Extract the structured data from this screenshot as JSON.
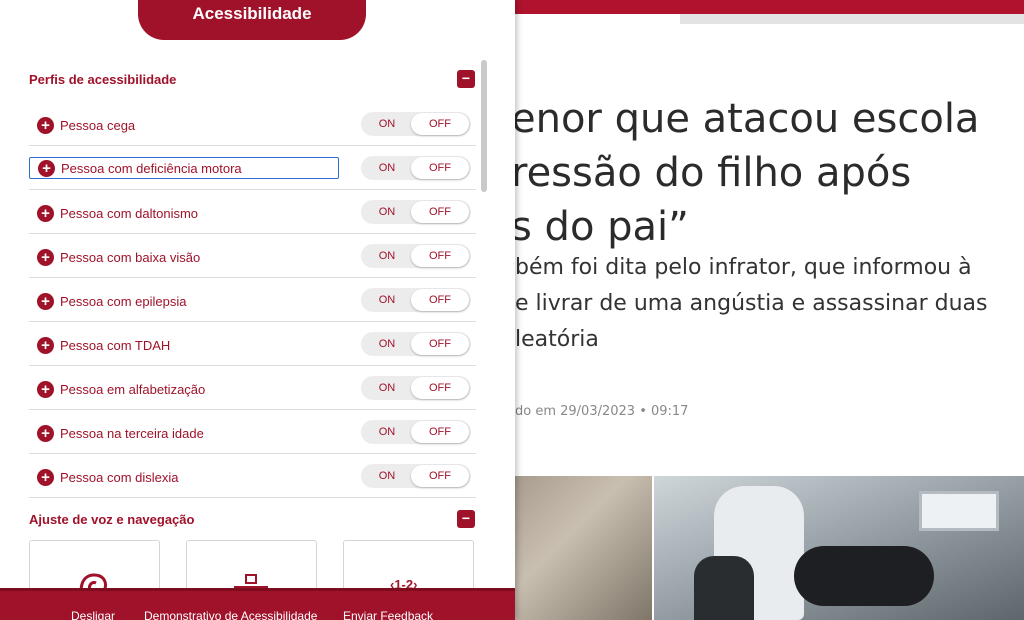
{
  "article": {
    "headline_lines": [
      "enor que atacou escola",
      "ressão do filho após",
      "s do pai”"
    ],
    "subtitle_lines": [
      "bém foi dita pelo infrator, que informou à",
      "e livrar de uma angústia e assassinar duas",
      "leatória"
    ],
    "meta": "do em 29/03/2023 • 09:17"
  },
  "panel": {
    "title": "Acessibilidade",
    "section_profiles": {
      "title": "Perfis de acessibilidade",
      "collapse_symbol": "−"
    },
    "toggle_on_label": "ON",
    "toggle_off_label": "OFF",
    "plus_symbol": "+",
    "profiles": [
      "Pessoa cega",
      "Pessoa com deficiência motora",
      "Pessoa com daltonismo",
      "Pessoa com baixa visão",
      "Pessoa com epilepsia",
      "Pessoa com TDAH",
      "Pessoa em alfabetização",
      "Pessoa na terceira idade",
      "Pessoa com dislexia"
    ],
    "focused_profile": "Pessoa com deficiência motora",
    "section_voice": {
      "title": "Ajuste de voz e navegação",
      "collapse_symbol": "−"
    },
    "tiles": [
      "ear-icon",
      "keyboard-icon",
      "shortcut-icon"
    ],
    "footer": {
      "disable": "Desligar",
      "demo": "Demonstrativo de Acessibilidade",
      "feedback": "Enviar Feedback"
    }
  },
  "colors": {
    "brand": "#a0122a",
    "focus": "#2f6fd4"
  }
}
